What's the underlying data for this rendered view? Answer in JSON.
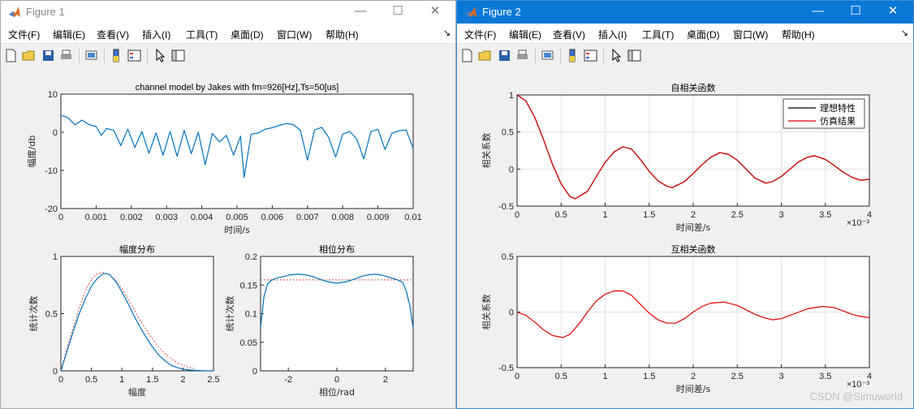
{
  "menu_items": [
    "文件(F)",
    "编辑(E)",
    "查看(V)",
    "插入(I)",
    "工具(T)",
    "桌面(D)",
    "窗口(W)",
    "帮助(H)"
  ],
  "window_controls": {
    "minimize": "—",
    "maximize": "☐",
    "close": "✕"
  },
  "watermark": "CSDN @Simuworld",
  "colors": {
    "signal": "#0072bd",
    "ref": "#000000",
    "sim": "#e00000",
    "dotted": "#d62020",
    "win2_title": "#0a78d7"
  },
  "windows": [
    {
      "title": "Figure 1",
      "plots": [
        {
          "title": "channel model by Jakes with fm=926[Hz],Ts=50[us]",
          "xlabel": "时间/s",
          "ylabel": "幅度/db",
          "xticks": [
            "0",
            "0.001",
            "0.002",
            "0.003",
            "0.004",
            "0.005",
            "0.006",
            "0.007",
            "0.008",
            "0.009",
            "0.01"
          ],
          "yticks": [
            "-20",
            "-10",
            "0",
            "10"
          ]
        },
        {
          "title": "幅度分布",
          "xlabel": "幅度",
          "ylabel": "统计次数",
          "xticks": [
            "0",
            "0.5",
            "1",
            "1.5",
            "2",
            "2.5"
          ],
          "yticks": [
            "0",
            "0.5",
            "1"
          ]
        },
        {
          "title": "相位分布",
          "xlabel": "相位/rad",
          "ylabel": "统计次数",
          "xticks": [
            "-2",
            "0",
            "2"
          ],
          "yticks": [
            "0",
            "0.05",
            "0.1",
            "0.15",
            "0.2"
          ]
        }
      ]
    },
    {
      "title": "Figure 2",
      "plots": [
        {
          "title": "自相关函数",
          "xlabel": "时间差/s",
          "ylabel": "相关系数",
          "xticks": [
            "0",
            "0.5",
            "1",
            "1.5",
            "2",
            "2.5",
            "3",
            "3.5",
            "4"
          ],
          "yticks": [
            "-0.5",
            "0",
            "0.5",
            "1"
          ],
          "exponent": "×10⁻³",
          "legend": [
            "理想特性",
            "仿真结果"
          ]
        },
        {
          "title": "互相关函数",
          "xlabel": "时间差/s",
          "ylabel": "相关系数",
          "xticks": [
            "0",
            "0.5",
            "1",
            "1.5",
            "2",
            "2.5",
            "3",
            "3.5",
            "4"
          ],
          "yticks": [
            "-0.5",
            "0",
            "0.5"
          ],
          "exponent": "×10⁻³"
        }
      ]
    }
  ],
  "chart_data": [
    {
      "type": "line",
      "title": "channel model by Jakes with fm=926[Hz],Ts=50[us]",
      "xlabel": "时间/s",
      "ylabel": "幅度/db",
      "xlim": [
        0,
        0.01
      ],
      "ylim": [
        -20,
        10
      ],
      "grid": false,
      "x": [
        0,
        0.0002,
        0.0004,
        0.0006,
        0.0008,
        0.001,
        0.00115,
        0.0013,
        0.0015,
        0.0017,
        0.0019,
        0.0021,
        0.0023,
        0.0025,
        0.0027,
        0.0029,
        0.0031,
        0.0033,
        0.0035,
        0.0037,
        0.0039,
        0.0041,
        0.0043,
        0.0045,
        0.0047,
        0.0049,
        0.0051,
        0.0052,
        0.0054,
        0.0056,
        0.0058,
        0.006,
        0.0062,
        0.0064,
        0.0066,
        0.0068,
        0.007,
        0.0072,
        0.0074,
        0.0076,
        0.0078,
        0.008,
        0.0082,
        0.0084,
        0.0086,
        0.0088,
        0.009,
        0.0092,
        0.0094,
        0.0096,
        0.0098,
        0.01
      ],
      "y": [
        4.5,
        3.8,
        2.0,
        3.2,
        2.0,
        1.5,
        -0.8,
        1.0,
        0.5,
        -3.5,
        0.8,
        -4,
        0.2,
        -5.5,
        -0.2,
        -6,
        0.2,
        -6.3,
        0.5,
        -5.6,
        0.0,
        -8.5,
        -0.3,
        -2.5,
        -0.8,
        -6,
        -1.0,
        -11.8,
        -0.5,
        -0.2,
        0.8,
        1.2,
        1.8,
        2.3,
        2.0,
        0.5,
        -7.3,
        0.6,
        1.3,
        -1.3,
        -6.5,
        -0.5,
        0.2,
        -1.8,
        -7.0,
        0.2,
        0.8,
        -4.5,
        -0.2,
        0.4,
        0.6,
        -4.2
      ]
    },
    {
      "type": "line",
      "title": "幅度分布",
      "xlabel": "幅度",
      "ylabel": "统计次数",
      "xlim": [
        0,
        2.5
      ],
      "ylim": [
        0,
        1
      ],
      "grid": false,
      "series": [
        {
          "style": "solid",
          "x": [
            0,
            0.1,
            0.2,
            0.3,
            0.4,
            0.5,
            0.6,
            0.7,
            0.75,
            0.8,
            0.9,
            1.0,
            1.1,
            1.2,
            1.3,
            1.4,
            1.5,
            1.6,
            1.7,
            1.8,
            1.9,
            2.0,
            2.1,
            2.2,
            2.3,
            2.4,
            2.5
          ],
          "y": [
            0,
            0.17,
            0.34,
            0.5,
            0.63,
            0.74,
            0.81,
            0.85,
            0.85,
            0.84,
            0.78,
            0.69,
            0.59,
            0.48,
            0.38,
            0.29,
            0.21,
            0.14,
            0.09,
            0.05,
            0.03,
            0.015,
            0.008,
            0.004,
            0.002,
            0.001,
            0
          ]
        },
        {
          "style": "dotted",
          "x": [
            0,
            0.1,
            0.2,
            0.3,
            0.4,
            0.5,
            0.6,
            0.7,
            0.8,
            0.9,
            1.0,
            1.1,
            1.2,
            1.3,
            1.4,
            1.5,
            1.6,
            1.7,
            1.8,
            1.9,
            2.0,
            2.1,
            2.2
          ],
          "y": [
            0,
            0.2,
            0.37,
            0.55,
            0.7,
            0.8,
            0.85,
            0.86,
            0.84,
            0.79,
            0.72,
            0.63,
            0.54,
            0.44,
            0.36,
            0.28,
            0.21,
            0.15,
            0.11,
            0.07,
            0.05,
            0.03,
            0.02
          ]
        }
      ]
    },
    {
      "type": "line",
      "title": "相位分布",
      "xlabel": "相位/rad",
      "ylabel": "统计次数",
      "xlim": [
        -3.1416,
        3.1416
      ],
      "ylim": [
        0,
        0.2
      ],
      "grid": false,
      "series": [
        {
          "style": "solid",
          "x": [
            -3.14,
            -3.0,
            -2.85,
            -2.7,
            -2.5,
            -2.2,
            -1.9,
            -1.6,
            -1.3,
            -1.0,
            -0.7,
            -0.4,
            0,
            0.4,
            0.7,
            1.0,
            1.3,
            1.6,
            1.9,
            2.2,
            2.5,
            2.7,
            2.85,
            3.0,
            3.14
          ],
          "y": [
            0.075,
            0.13,
            0.152,
            0.158,
            0.162,
            0.165,
            0.168,
            0.169,
            0.168,
            0.165,
            0.16,
            0.156,
            0.153,
            0.156,
            0.16,
            0.165,
            0.168,
            0.169,
            0.167,
            0.163,
            0.159,
            0.155,
            0.14,
            0.115,
            0.075
          ]
        },
        {
          "style": "dotted",
          "x": [
            -3.14,
            3.14
          ],
          "y": [
            0.159,
            0.159
          ]
        }
      ]
    },
    {
      "type": "line",
      "title": "自相关函数",
      "xlabel": "时间差/s",
      "ylabel": "相关系数",
      "xlim": [
        0,
        4
      ],
      "ylim": [
        -0.5,
        1
      ],
      "grid": true,
      "legend": "top-right",
      "x_unit": "×10⁻³",
      "series": [
        {
          "name": "理想特性",
          "x": [
            0,
            0.1,
            0.2,
            0.3,
            0.4,
            0.5,
            0.6,
            0.66,
            0.8,
            0.9,
            1.0,
            1.1,
            1.2,
            1.3,
            1.4,
            1.5,
            1.6,
            1.7,
            1.76,
            1.9,
            2.0,
            2.1,
            2.2,
            2.3,
            2.4,
            2.5,
            2.6,
            2.7,
            2.82,
            2.9,
            3.0,
            3.1,
            3.2,
            3.3,
            3.38,
            3.5,
            3.6,
            3.7,
            3.8,
            3.9,
            4.0
          ],
          "y": [
            1,
            0.92,
            0.7,
            0.4,
            0.07,
            -0.2,
            -0.37,
            -0.4,
            -0.3,
            -0.1,
            0.09,
            0.23,
            0.3,
            0.27,
            0.13,
            -0.03,
            -0.16,
            -0.23,
            -0.25,
            -0.17,
            -0.06,
            0.06,
            0.16,
            0.22,
            0.2,
            0.12,
            0.0,
            -0.12,
            -0.19,
            -0.17,
            -0.1,
            0.0,
            0.1,
            0.16,
            0.18,
            0.13,
            0.05,
            -0.04,
            -0.11,
            -0.15,
            -0.14
          ]
        },
        {
          "name": "仿真结果",
          "x": [
            0,
            0.1,
            0.2,
            0.3,
            0.4,
            0.5,
            0.6,
            0.66,
            0.8,
            0.9,
            1.0,
            1.1,
            1.2,
            1.3,
            1.4,
            1.5,
            1.6,
            1.7,
            1.76,
            1.9,
            2.0,
            2.1,
            2.2,
            2.3,
            2.4,
            2.5,
            2.6,
            2.7,
            2.82,
            2.9,
            3.0,
            3.1,
            3.2,
            3.3,
            3.38,
            3.5,
            3.6,
            3.7,
            3.8,
            3.9,
            4.0
          ],
          "y": [
            1,
            0.92,
            0.7,
            0.4,
            0.07,
            -0.2,
            -0.37,
            -0.4,
            -0.3,
            -0.1,
            0.09,
            0.23,
            0.3,
            0.27,
            0.13,
            -0.03,
            -0.16,
            -0.23,
            -0.25,
            -0.17,
            -0.06,
            0.06,
            0.16,
            0.22,
            0.2,
            0.12,
            0.0,
            -0.12,
            -0.19,
            -0.17,
            -0.1,
            0.0,
            0.1,
            0.16,
            0.18,
            0.13,
            0.05,
            -0.04,
            -0.11,
            -0.15,
            -0.14
          ]
        }
      ]
    },
    {
      "type": "line",
      "title": "互相关函数",
      "xlabel": "时间差/s",
      "ylabel": "相关系数",
      "xlim": [
        0,
        4
      ],
      "ylim": [
        -0.5,
        0.5
      ],
      "grid": true,
      "x_unit": "×10⁻³",
      "series": [
        {
          "x": [
            0,
            0.1,
            0.2,
            0.3,
            0.4,
            0.52,
            0.6,
            0.7,
            0.8,
            0.9,
            1.0,
            1.1,
            1.2,
            1.3,
            1.4,
            1.5,
            1.6,
            1.7,
            1.8,
            1.9,
            2.0,
            2.1,
            2.2,
            2.35,
            2.5,
            2.6,
            2.7,
            2.8,
            2.9,
            3.0,
            3.1,
            3.2,
            3.3,
            3.47,
            3.6,
            3.7,
            3.8,
            3.9,
            4.0
          ],
          "y": [
            0,
            -0.03,
            -0.09,
            -0.16,
            -0.21,
            -0.23,
            -0.2,
            -0.11,
            0.0,
            0.1,
            0.16,
            0.19,
            0.19,
            0.15,
            0.07,
            -0.01,
            -0.07,
            -0.1,
            -0.1,
            -0.06,
            0.0,
            0.05,
            0.08,
            0.09,
            0.06,
            0.02,
            -0.02,
            -0.05,
            -0.07,
            -0.06,
            -0.03,
            0.0,
            0.03,
            0.05,
            0.04,
            0.01,
            -0.02,
            -0.04,
            -0.05
          ]
        }
      ]
    }
  ]
}
